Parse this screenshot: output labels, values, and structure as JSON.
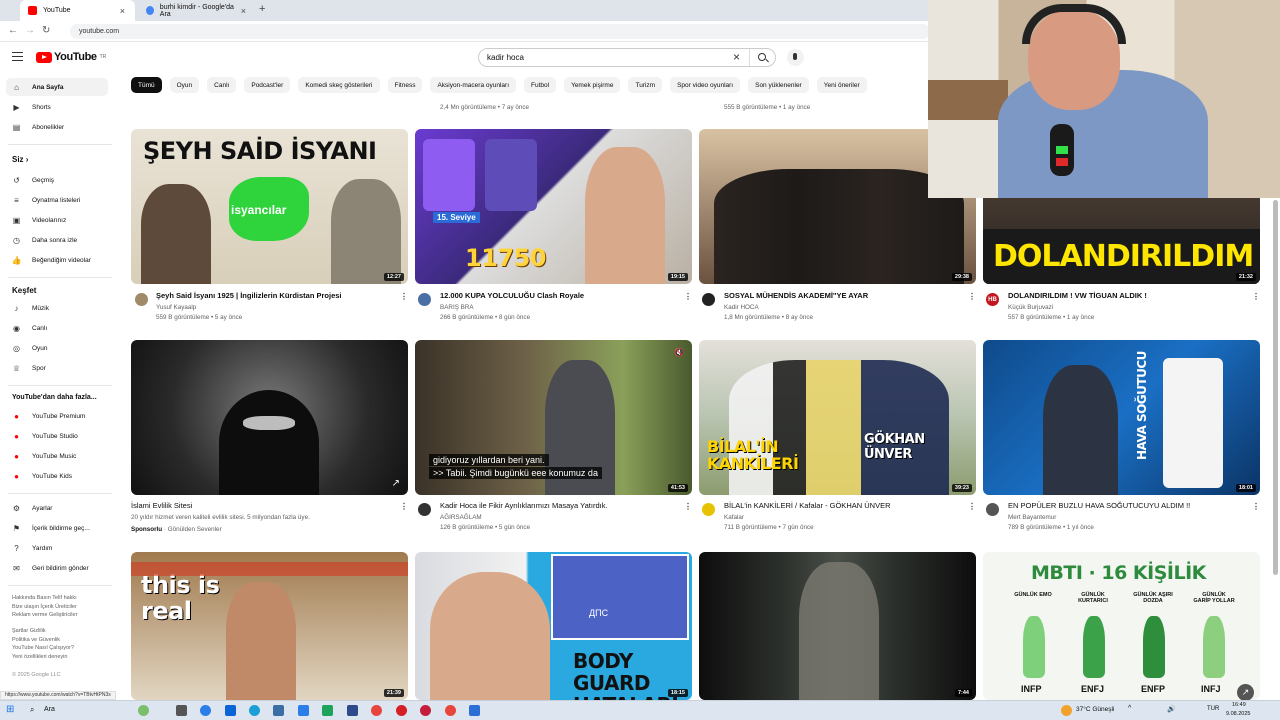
{
  "browser": {
    "tabs": [
      {
        "label": "YouTube"
      },
      {
        "label": "burhi kimdir - Google'da Ara"
      }
    ],
    "new_tab": "+",
    "url": "youtube.com",
    "status_url": "https://www.youtube.com/watch?v=TBtvHtPN3s"
  },
  "header": {
    "logo_text": "YouTube",
    "logo_region": "TR",
    "search_value": "kadir hoca"
  },
  "chips": [
    "Tümü",
    "Oyun",
    "Canlı",
    "Podcast'ler",
    "Komedi skeç gösterileri",
    "Fitness",
    "Aksiyon-macera oyunları",
    "Futbol",
    "Yemek pişirme",
    "Turizm",
    "Spor video oyunları",
    "Son yüklenenler",
    "Yeni öneriler"
  ],
  "sidebar": {
    "main": [
      {
        "label": "Ana Sayfa",
        "icon": "home-icon"
      },
      {
        "label": "Shorts",
        "icon": "shorts-icon"
      },
      {
        "label": "Abonelikler",
        "icon": "subscriptions-icon"
      }
    ],
    "you_heading": "Siz",
    "you": [
      {
        "label": "Geçmiş",
        "icon": "history-icon"
      },
      {
        "label": "Oynatma listeleri",
        "icon": "playlist-icon"
      },
      {
        "label": "Videolarınız",
        "icon": "your-videos-icon"
      },
      {
        "label": "Daha sonra izle",
        "icon": "clock-icon"
      },
      {
        "label": "Beğendiğim videolar",
        "icon": "thumb-up-icon"
      }
    ],
    "explore_heading": "Keşfet",
    "explore": [
      {
        "label": "Müzik",
        "icon": "music-icon"
      },
      {
        "label": "Canlı",
        "icon": "live-icon"
      },
      {
        "label": "Oyun",
        "icon": "gaming-icon"
      },
      {
        "label": "Spor",
        "icon": "trophy-icon"
      }
    ],
    "more_heading": "YouTube'dan daha fazla...",
    "more": [
      {
        "label": "YouTube Premium"
      },
      {
        "label": "YouTube Studio"
      },
      {
        "label": "YouTube Music"
      },
      {
        "label": "YouTube Kids"
      }
    ],
    "settings": [
      {
        "label": "Ayarlar",
        "icon": "gear-icon"
      },
      {
        "label": "İçerik bildirme geç...",
        "icon": "flag-icon"
      },
      {
        "label": "Yardım",
        "icon": "help-icon"
      },
      {
        "label": "Geri bildirim gönder",
        "icon": "feedback-icon"
      }
    ],
    "footer1": "Hakkında  Basın  Telif hakkı\nBize ulaşın  İçerik Üreticiler\nReklam verme  Geliştiriciler",
    "footer2": "Şartlar  Gizlilik\nPolitika ve Güvenlik\nYouTube Nasıl Çalışıyor?\nYeni özellikleri deneyin",
    "copyright": "© 2025 Google LLC"
  },
  "top_meta": [
    {
      "meta": "2,4 Mn görüntüleme • 7 ay önce"
    },
    {
      "meta": "555 B görüntüleme • 1 ay önce"
    }
  ],
  "videos": [
    {
      "title": "Şeyh Said İsyanı 1925 | İngilizlerin Kürdistan Projesi",
      "channel": "Yusuf Kayaalp",
      "meta": "559 B görüntüleme • 5 ay önce",
      "duration": "12:27",
      "thumb_text": "ŞEYH SAİD İSYANI",
      "thumb_sub": "isyancılar"
    },
    {
      "title": "12.000 KUPA YOLCULUĞU Clash Royale",
      "channel": "BARIŞ BRA",
      "meta": "266 B görüntüleme • 8 gün önce",
      "duration": "19:15",
      "thumb_text": "11750",
      "thumb_sub": "15. Seviye"
    },
    {
      "title": "SOSYAL MÜHENDİS AKADEMİ\"YE AYAR",
      "channel": "Kadir HOCA",
      "meta": "1,8 Mn görüntüleme • 8 ay önce",
      "duration": "29:38"
    },
    {
      "title": "DOLANDIRILDIM ! VW TİGUAN ALDIK !",
      "channel": "Küçük Burjuvazi",
      "meta": "557 B görüntüleme • 1 ay önce",
      "duration": "21:32",
      "thumb_text": "DOLANDIRILDIM",
      "avatar_text": "HB"
    },
    {
      "title": "İslami Evlilik Sitesi",
      "sub": "20 yıldır hizmet veren kaliteli evlilik sitesi. 5 milyondan fazla üye.",
      "sponsor": "Sponsorlu",
      "channel": "Gönülden Sevenler"
    },
    {
      "title": "Kadir Hoca ile Fikir Ayrılıklarımızı Masaya Yatırdık.",
      "channel": "AĞIRSAĞLAM",
      "meta": "126 B görüntüleme • 5 gün önce",
      "duration": "41:53",
      "caption1": "gidiyoruz yıllardan beri yani.",
      "caption2": ">> Tabii. Şimdi bugünkü eee konumuz da"
    },
    {
      "title": "BİLAL'in KANKİLERİ / Kafalar - GÖKHAN ÜNVER",
      "channel": "Kafalar",
      "meta": "711 B görüntüleme • 7 gün önce",
      "duration": "39:23",
      "thumb_text": "BİLAL'İN KANKİLERİ",
      "thumb_sub": "GÖKHAN ÜNVER"
    },
    {
      "title": "EN POPÜLER BUZLU HAVA SOĞUTUCUYU ALDIM !!",
      "channel": "Mert Bayantemur",
      "meta": "789 B görüntüleme • 1 yıl önce",
      "duration": "18:01",
      "thumb_text": "HAVA SOĞUTUCU"
    },
    {
      "duration": "21:39",
      "thumb_text": "this is real"
    },
    {
      "duration": "18:15",
      "thumb_text": "BODY GUARD HATALARI",
      "thumb_sub": "ДПС"
    },
    {
      "duration": "7:44"
    },
    {
      "thumb_text": "MBTI · 16 KİŞİLİK",
      "labels": [
        "GÜNLÜK EMO",
        "GÜNLÜK KURTARICI",
        "GÜNLÜK AŞIRI DOZDA",
        "GÜNLÜK GARİP YOLLAR"
      ],
      "types": [
        "INFP",
        "ENFJ",
        "ENFP",
        "INFJ"
      ]
    }
  ],
  "taskbar": {
    "search": "Ara",
    "weather": "37°C  Güneşli",
    "lang": "TUR",
    "time": "16:49",
    "date": "9.08.2025"
  },
  "colors": {
    "brand_red": "#ff0000",
    "chip_active": "#0f0f0f",
    "chip_bg": "#f2f2f2"
  }
}
